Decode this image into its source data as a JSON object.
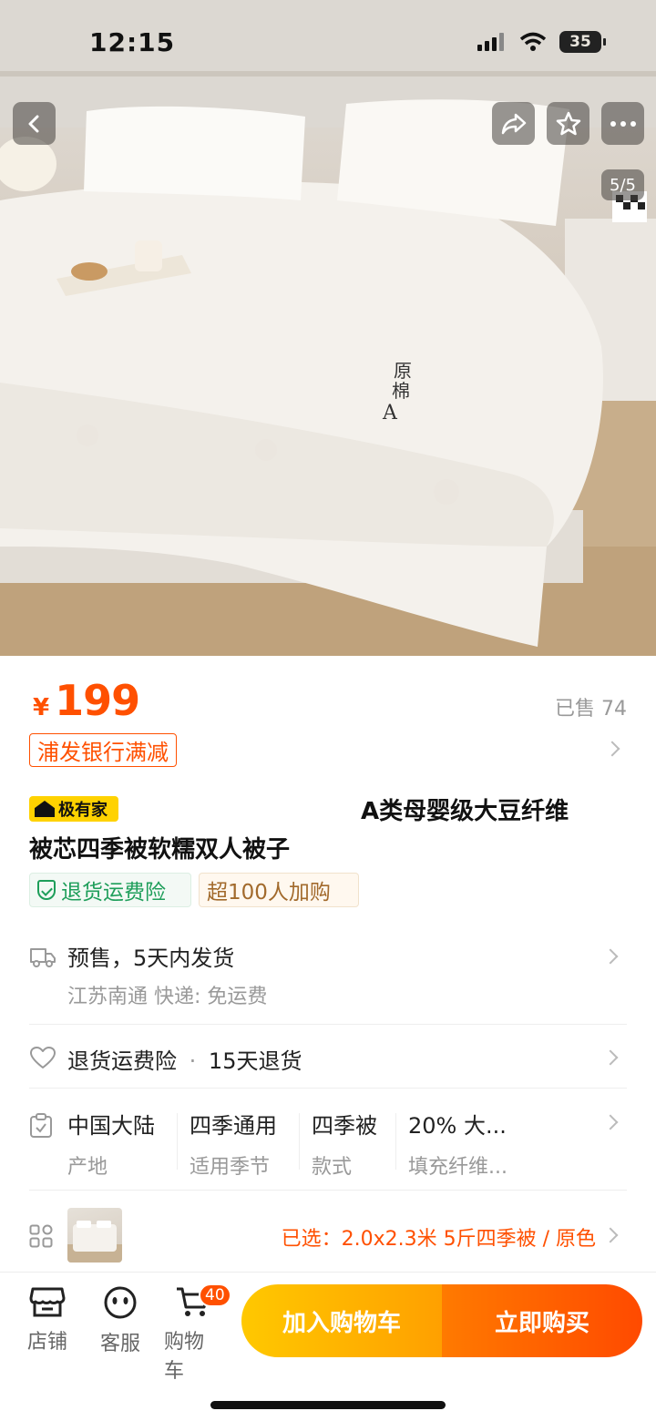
{
  "status_bar": {
    "time": "12:15",
    "battery": "35"
  },
  "gallery": {
    "counter": "5/5"
  },
  "price": {
    "currency": "¥",
    "value": "199",
    "sold": "已售 74"
  },
  "promotion": {
    "tag": "浦发银行满减"
  },
  "product": {
    "brand_badge": "极有家",
    "title_line1": "A类母婴级大豆纤维",
    "title_line2": "被芯四季被软糯双人被子"
  },
  "chips": {
    "guarantee": "退货运费险",
    "popularity": "超100人加购"
  },
  "shipping": {
    "main": "预售，5天内发货",
    "sub": "江苏南通  快递: 免运费"
  },
  "service": {
    "main": "退货运费险",
    "sep": "·",
    "detail": "15天退货"
  },
  "specs": [
    {
      "value": "中国大陆",
      "key": "产地"
    },
    {
      "value": "四季通用",
      "key": "适用季节"
    },
    {
      "value": "四季被",
      "key": "款式"
    },
    {
      "value": "20% 大...",
      "key": "填充纤维..."
    }
  ],
  "selection": {
    "text": "已选：2.0x2.3米 5斤四季被 / 原色"
  },
  "bottom_bar": {
    "store": "店铺",
    "service": "客服",
    "cart": "购物车",
    "cart_count": "40",
    "add_to_cart": "加入购物车",
    "buy_now": "立即购买"
  },
  "colors": {
    "accent": "#ff5000",
    "green": "#1e9e5a",
    "cart_button": "#ffa000",
    "buy_button": "#ff4a00"
  }
}
